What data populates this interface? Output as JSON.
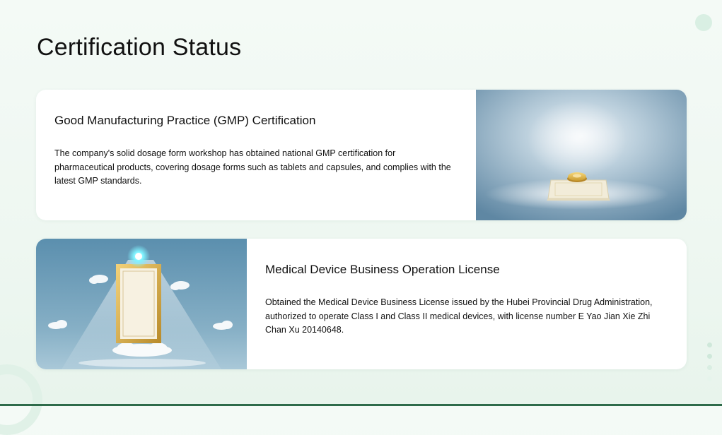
{
  "page": {
    "title": "Certification Status"
  },
  "cards": [
    {
      "title": "Good Manufacturing Practice (GMP) Certification",
      "description": "The company's solid dosage form workshop has obtained national GMP certification for pharmaceutical products, covering dosage forms such as tablets and capsules, and complies with the latest GMP standards.",
      "image": "certificate-on-pedestal-illustration"
    },
    {
      "title": "Medical Device Business Operation License",
      "description": "Obtained the Medical Device Business License issued by the Hubei Provincial Drug Administration, authorized to operate Class I and Class II medical devices, with license number E Yao Jian Xie Zhi Chan Xu 20140648.",
      "image": "framed-certificate-spotlight-illustration"
    }
  ],
  "colors": {
    "background": "#eef7f1",
    "card": "#ffffff",
    "accent": "#2e6b4a",
    "image_blue": "#5d8aa8"
  }
}
